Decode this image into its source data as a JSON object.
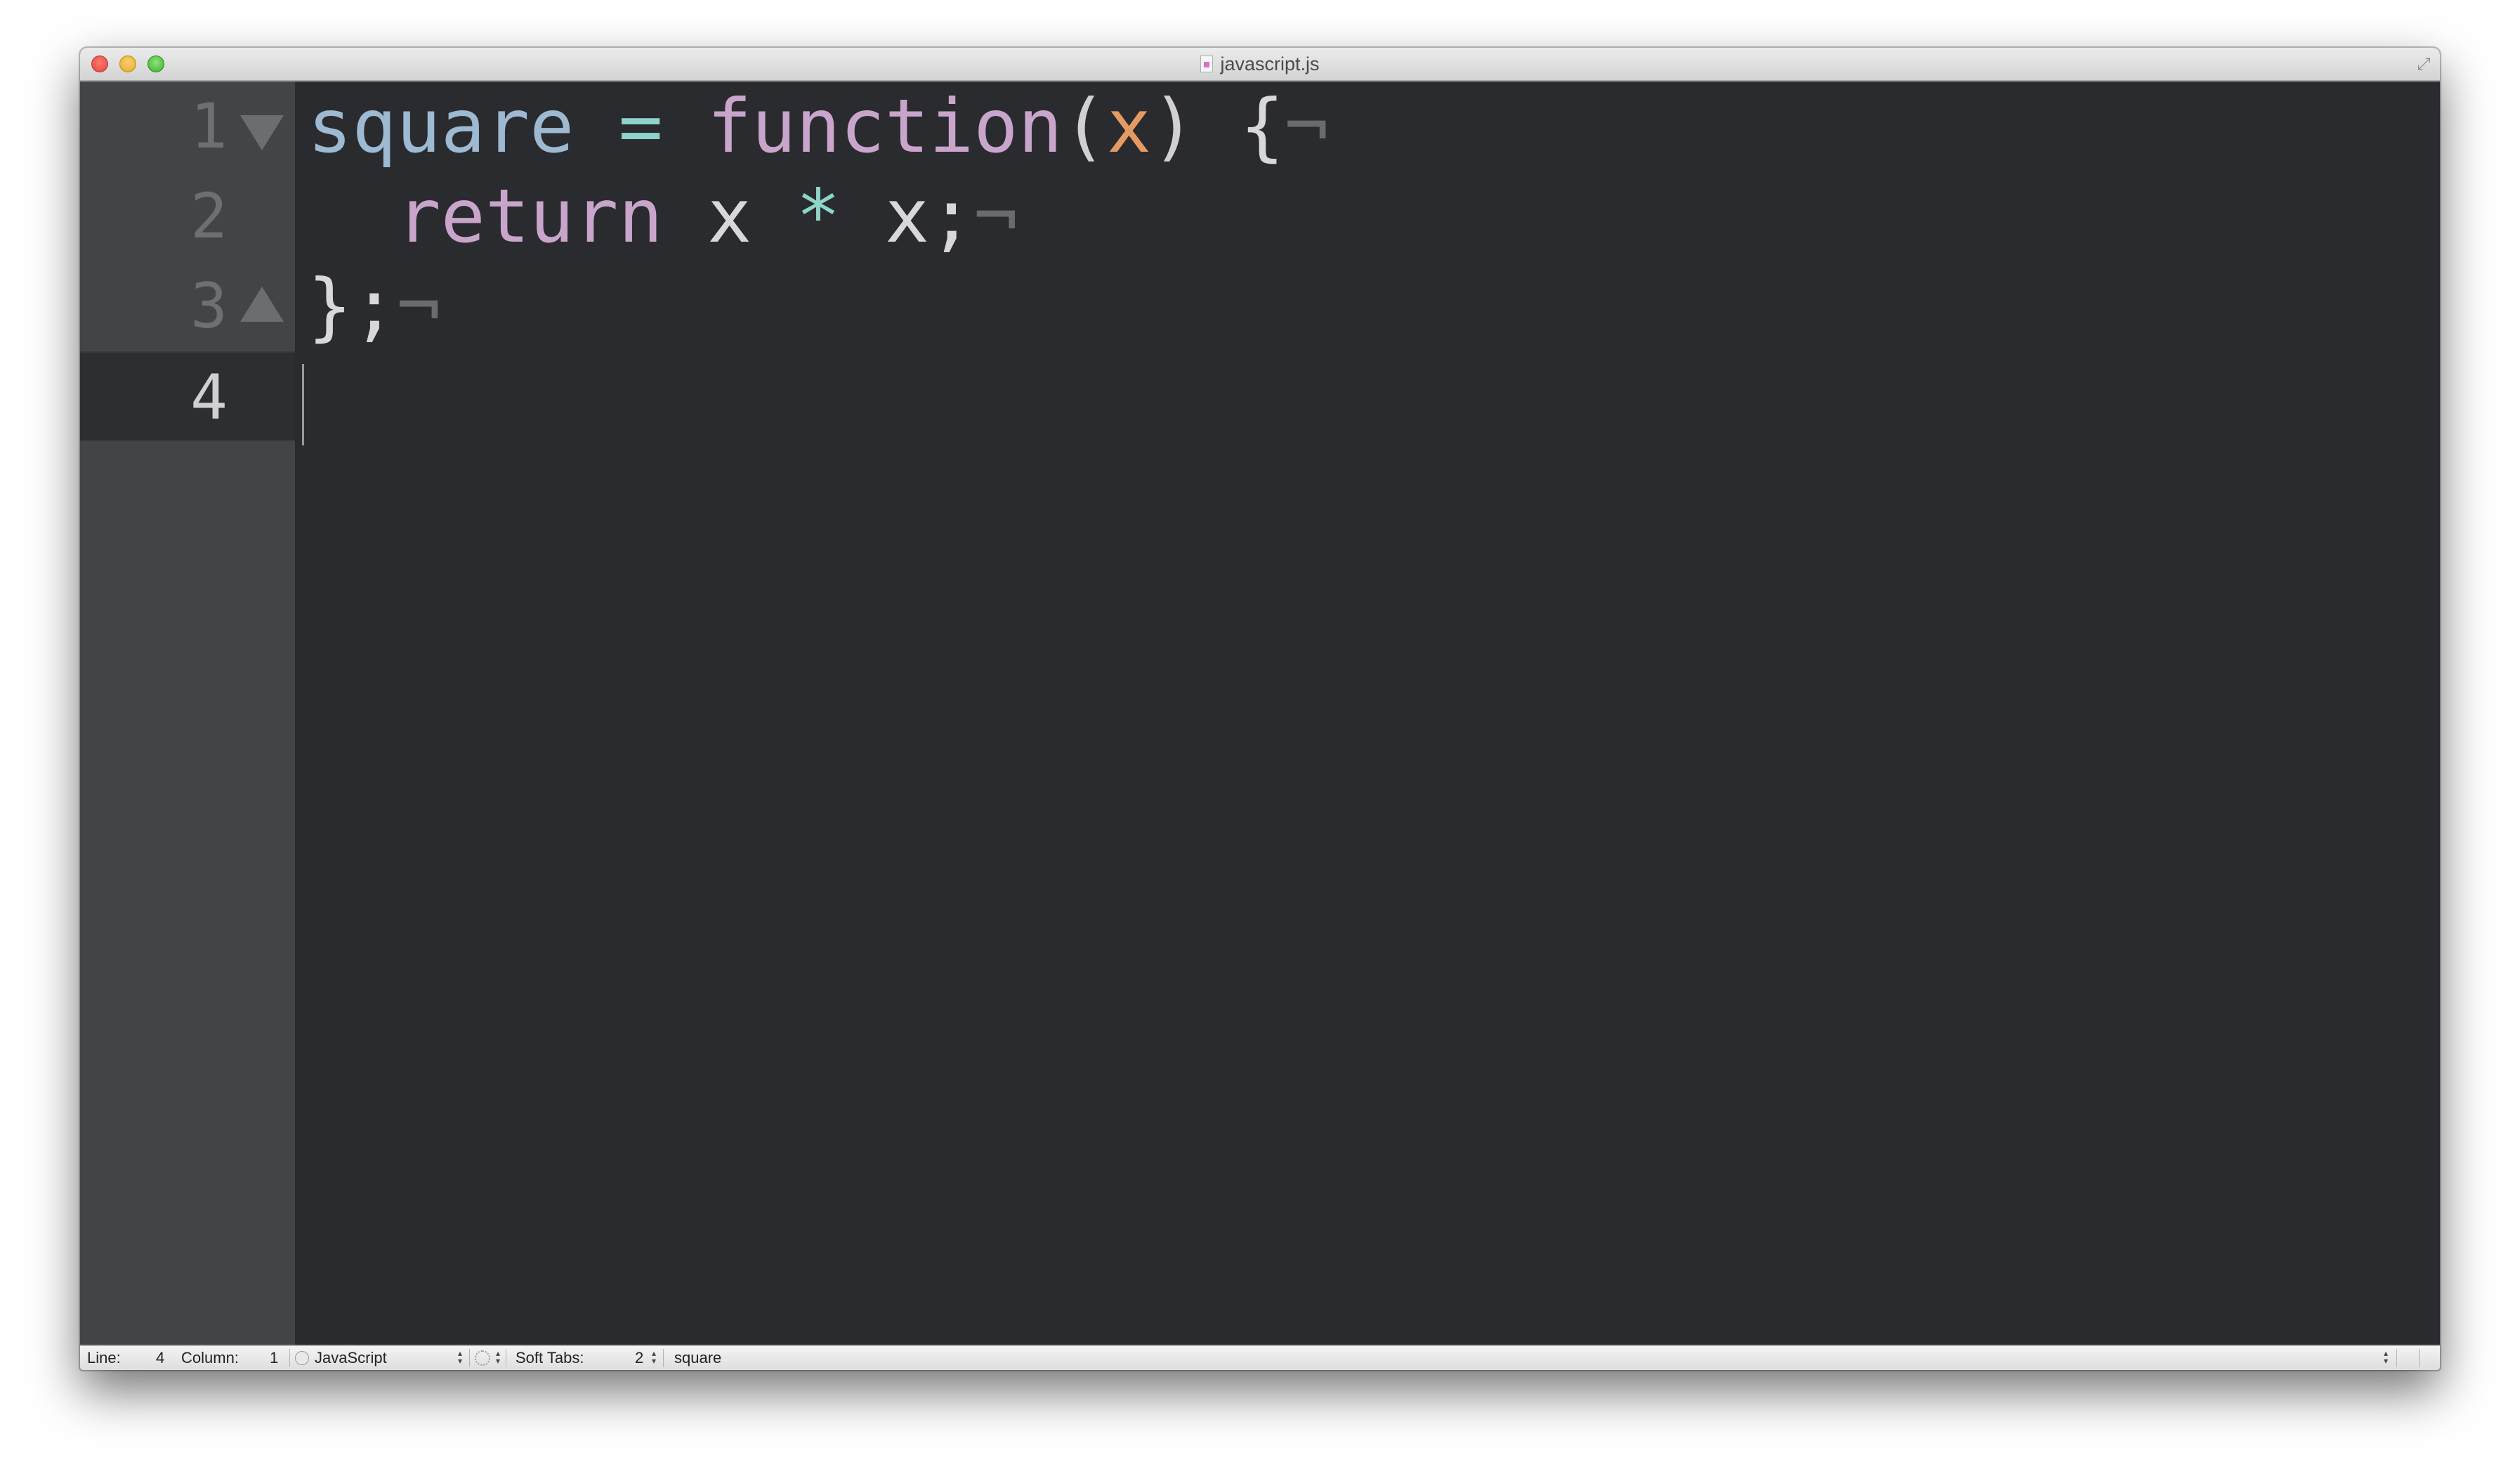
{
  "window": {
    "title": "javascript.js",
    "file_icon": "javascript-file-icon"
  },
  "gutter": {
    "line_numbers": [
      "1",
      "2",
      "3",
      "4"
    ],
    "current_line": "4",
    "fold_markers": [
      {
        "line": "1",
        "icon": "fold-open-triangle-icon"
      },
      {
        "line": "3",
        "icon": "fold-close-triangle-icon"
      }
    ]
  },
  "code": {
    "lines": [
      {
        "tokens": [
          {
            "type": "variable",
            "text": "square"
          },
          {
            "type": "plain",
            "text": " "
          },
          {
            "type": "operator",
            "text": "="
          },
          {
            "type": "plain",
            "text": " "
          },
          {
            "type": "keyword",
            "text": "function"
          },
          {
            "type": "paren",
            "text": "("
          },
          {
            "type": "param",
            "text": "x"
          },
          {
            "type": "paren",
            "text": ")"
          },
          {
            "type": "plain",
            "text": " {"
          },
          {
            "type": "invisible",
            "text": "¬"
          }
        ]
      },
      {
        "tokens": [
          {
            "type": "plain",
            "text": "  "
          },
          {
            "type": "keyword",
            "text": "return"
          },
          {
            "type": "plain",
            "text": " x "
          },
          {
            "type": "operator",
            "text": "*"
          },
          {
            "type": "plain",
            "text": " x;"
          },
          {
            "type": "invisible",
            "text": "¬"
          }
        ]
      },
      {
        "tokens": [
          {
            "type": "plain",
            "text": "};"
          },
          {
            "type": "invisible",
            "text": "¬"
          }
        ]
      },
      {
        "tokens": []
      }
    ]
  },
  "statusbar": {
    "line_label": "Line:",
    "line_value": "4",
    "column_label": "Column:",
    "column_value": "1",
    "language": "JavaScript",
    "soft_tabs_label": "Soft Tabs:",
    "soft_tabs_value": "2",
    "symbol": "square"
  },
  "colors": {
    "editor_background": "#2a2b2f",
    "gutter_background": "#434447",
    "variable": "#9eb9d2",
    "operator": "#8fd4c8",
    "keyword": "#c9a5cc",
    "parameter": "#e69a63",
    "plain": "#d8d8d8",
    "invisible": "#6a6b6e"
  }
}
